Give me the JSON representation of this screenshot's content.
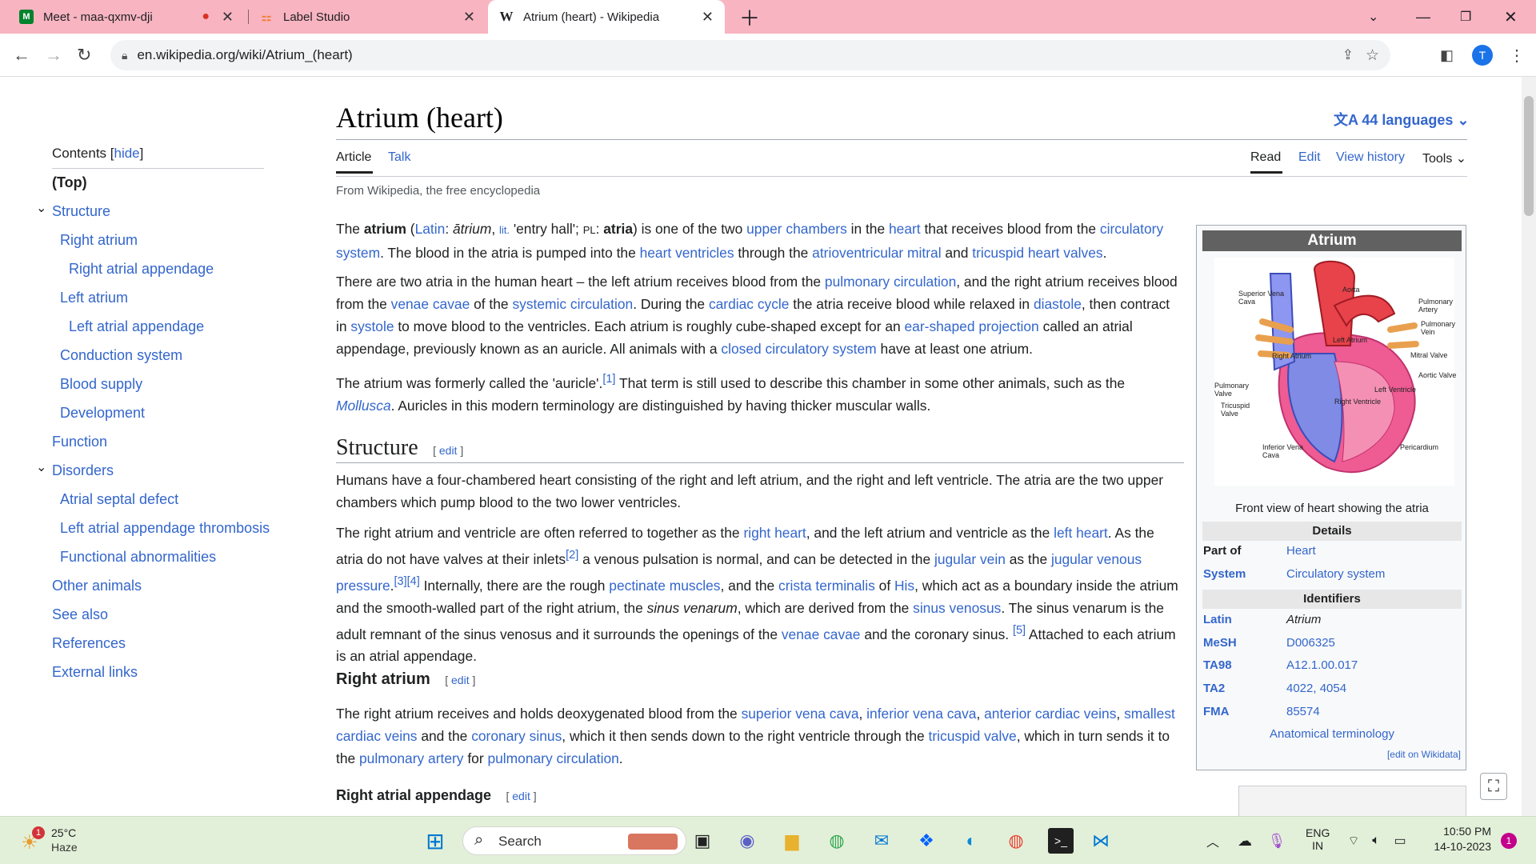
{
  "browser": {
    "tabs": [
      {
        "title": "Meet - maa-qxmv-dji",
        "recording": "●"
      },
      {
        "title": "Label Studio"
      },
      {
        "title": "Atrium (heart) - Wikipedia",
        "favicon": "W"
      }
    ],
    "url": "en.wikipedia.org/wiki/Atrium_(heart)",
    "profile_initial": "T"
  },
  "wiki": {
    "title": "Atrium (heart)",
    "languages": "44 languages",
    "tabs": {
      "article": "Article",
      "talk": "Talk",
      "read": "Read",
      "edit": "Edit",
      "history": "View history",
      "tools": "Tools"
    },
    "tagline": "From Wikipedia, the free encyclopedia",
    "toc": {
      "heading": "Contents",
      "hide": "hide",
      "items": [
        "(Top)",
        "Structure",
        "Right atrium",
        "Right atrial appendage",
        "Left atrium",
        "Left atrial appendage",
        "Conduction system",
        "Blood supply",
        "Development",
        "Function",
        "Disorders",
        "Atrial septal defect",
        "Left atrial appendage thrombosis",
        "Functional abnormalities",
        "Other animals",
        "See also",
        "References",
        "External links"
      ]
    },
    "sections": {
      "structure": "Structure",
      "right_atrium": "Right atrium",
      "right_atrial_appendage": "Right atrial appendage",
      "edit": "edit"
    }
  },
  "infobox": {
    "title": "Atrium",
    "caption": "Front view of heart showing the atria",
    "details": "Details",
    "part_of_label": "Part of",
    "part_of": "Heart",
    "system_label": "System",
    "system": "Circulatory system",
    "identifiers": "Identifiers",
    "latin_label": "Latin",
    "latin": "Atrium",
    "mesh_label": "MeSH",
    "mesh": "D006325",
    "ta98_label": "TA98",
    "ta98": "A12.1.00.017",
    "ta2_label": "TA2",
    "ta2": "4022, 4054",
    "fma_label": "FMA",
    "fma": "85574",
    "anat": "Anatomical terminology",
    "wikidata": "[edit on Wikidata]",
    "diagram_labels": [
      "Superior Vena Cava",
      "Aorta",
      "Pulmonary Artery",
      "Pulmonary Vein",
      "Left Atrium",
      "Right Atrium",
      "Mitral Valve",
      "Aortic Valve",
      "Pulmonary Valve",
      "Left Ventricle",
      "Tricuspid Valve",
      "Right Ventricle",
      "Inferior Vena Cava",
      "Pericardium"
    ]
  },
  "taskbar": {
    "weather_temp": "25°C",
    "weather_desc": "Haze",
    "weather_badge": "1",
    "search": "Search",
    "lang1": "ENG",
    "lang2": "IN",
    "time": "10:50 PM",
    "date": "14-10-2023",
    "notif": "1"
  }
}
